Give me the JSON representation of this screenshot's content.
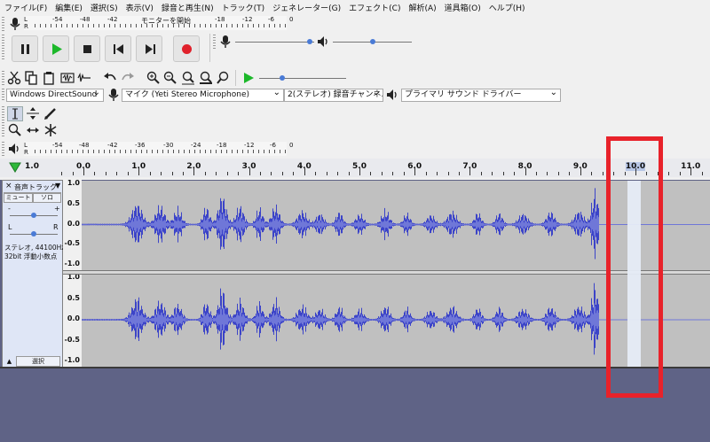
{
  "menu": [
    "ファイル(F)",
    "編集(E)",
    "選択(S)",
    "表示(V)",
    "録音と再生(N)",
    "トラック(T)",
    "ジェネレーター(G)",
    "エフェクト(C)",
    "解析(A)",
    "道具箱(O)",
    "ヘルプ(H)"
  ],
  "record_meter": {
    "scale": [
      "-54",
      "-48",
      "-42",
      "モニターを開始",
      "-18",
      "-12",
      "-6",
      "0"
    ],
    "l": "L",
    "r": "R"
  },
  "playback_meter": {
    "scale": [
      "-54",
      "-48",
      "-42",
      "-36",
      "-30",
      "-24",
      "-18",
      "-12",
      "-6",
      "0"
    ],
    "l": "L",
    "r": "R"
  },
  "transport": {
    "icons": [
      "pause-icon",
      "play-icon",
      "stop-icon",
      "skip-start-icon",
      "skip-end-icon",
      "record-icon"
    ]
  },
  "mixer": {
    "record_volume": 0.98,
    "playback_volume": 0.5
  },
  "play_at_speed": {
    "speed": 0.25
  },
  "device": {
    "host": "Windows DirectSound",
    "recording_device": "マイク (Yeti Stereo Microphone)",
    "channels": "2(ステレオ) 録音チャンネル",
    "playback_device": "プライマリ サウンド ドライバー"
  },
  "timeline": {
    "labels": [
      "1.0",
      "0.0",
      "1.0",
      "2.0",
      "3.0",
      "4.0",
      "5.0",
      "6.0",
      "7.0",
      "8.0",
      "9.0",
      "10.0",
      "11.0"
    ],
    "highlighted": "10.0"
  },
  "track": {
    "name": "音声トラック",
    "mute": "ミュート",
    "solo": "ソロ",
    "gain_minus": "-",
    "gain_plus": "+",
    "pan_left": "L",
    "pan_right": "R",
    "info_line1": "ステレオ, 44100Hz",
    "info_line2": "32bit 浮動小数点",
    "select": "選択",
    "close": "×",
    "collapse": "▲"
  },
  "yaxis": [
    "1.0",
    "0.5",
    "0.0",
    "-0.5",
    "-1.0"
  ],
  "colors": {
    "waveform": "#3c44c8",
    "waveform_light": "#6f77d8",
    "highlight": "#e8222a",
    "background": "#5f6386"
  }
}
